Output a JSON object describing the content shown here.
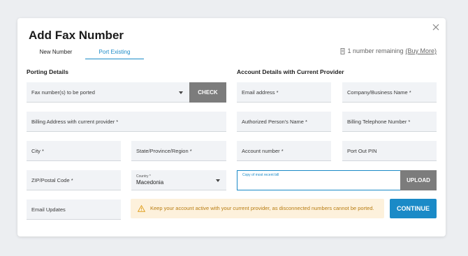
{
  "dialog": {
    "title": "Add Fax Number",
    "close_icon": "close-icon"
  },
  "tabs": [
    {
      "label": "New Number",
      "active": false
    },
    {
      "label": "Port Existing",
      "active": true
    }
  ],
  "remaining": {
    "icon": "fax-icon",
    "text": "1 number remaining",
    "link": "(Buy More)"
  },
  "porting": {
    "heading": "Porting Details",
    "fax_numbers_placeholder": "Fax number(s) to be ported",
    "check_label": "CHECK",
    "billing_address": "Billing Address with current provider *",
    "city": "City *",
    "state": "State/Province/Region *",
    "zip": "ZIP/Postal Code *",
    "country_label": "Country *",
    "country_value": "Macedonia",
    "email_updates": "Email Updates"
  },
  "account": {
    "heading": "Account Details with Current Provider",
    "email": "Email address *",
    "company": "Company/Business Name *",
    "authorized": "Authorized Person's Name *",
    "billing_phone": "Billing Telephone Number *",
    "account_number": "Account number *",
    "port_out_pin": "Port Out PIN",
    "bill_label": "Copy of most recent bill",
    "upload_label": "UPLOAD"
  },
  "warning": {
    "icon": "warning-icon",
    "text": "Keep your account active with your current provider, as disconnected numbers cannot be ported.",
    "color": "#b87c10"
  },
  "continue_label": "CONTINUE",
  "colors": {
    "accent": "#1a8ac7",
    "warning_bg": "#fdf1dc",
    "button_gray": "#7c7c7c"
  }
}
